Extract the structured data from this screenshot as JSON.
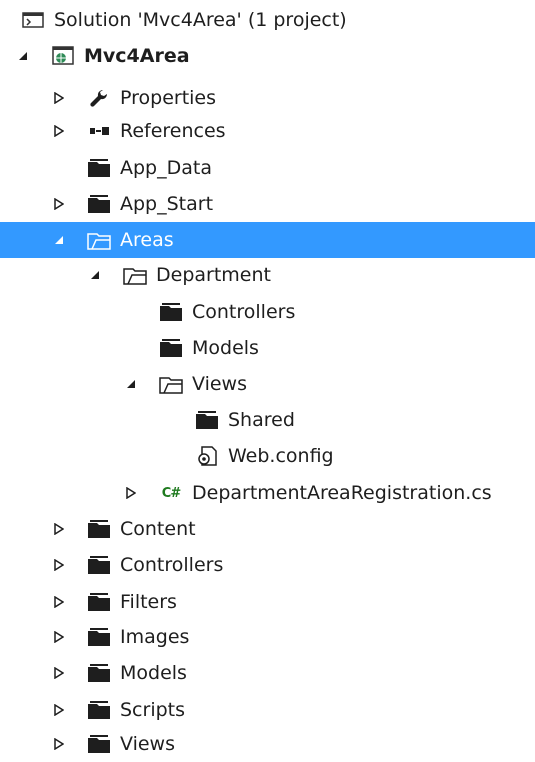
{
  "solution": {
    "label": "Solution 'Mvc4Area' (1 project)"
  },
  "project": {
    "label": "Mvc4Area"
  },
  "items": {
    "properties": "Properties",
    "references": "References",
    "app_data": "App_Data",
    "app_start": "App_Start",
    "areas": "Areas",
    "department": "Department",
    "dept_controllers": "Controllers",
    "dept_models": "Models",
    "dept_views": "Views",
    "dept_shared": "Shared",
    "dept_webconfig": "Web.config",
    "dept_registration": "DepartmentAreaRegistration.cs",
    "content": "Content",
    "controllers": "Controllers",
    "filters": "Filters",
    "images": "Images",
    "models": "Models",
    "scripts": "Scripts",
    "views": "Views"
  },
  "icons": {
    "cs_badge": "C#"
  },
  "colors": {
    "selection": "#3399ff",
    "folder": "#1e1e1e",
    "csharp": "#1e7a1e"
  }
}
